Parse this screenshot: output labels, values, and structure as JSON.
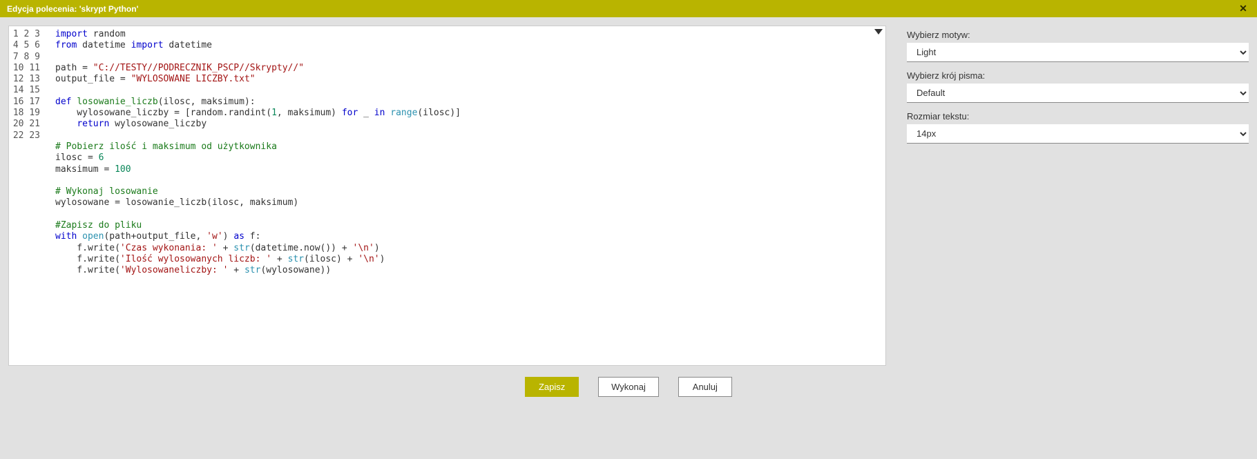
{
  "title": "Edycja polecenia: 'skrypt Python'",
  "close_symbol": "✕",
  "code": {
    "line_count": 23,
    "tokens": [
      [
        [
          "kw",
          "import"
        ],
        [
          "",
          " random"
        ]
      ],
      [
        [
          "kw",
          "from"
        ],
        [
          "",
          " datetime "
        ],
        [
          "kw",
          "import"
        ],
        [
          "",
          " datetime"
        ]
      ],
      [
        [
          "",
          ""
        ]
      ],
      [
        [
          "",
          "path = "
        ],
        [
          "str",
          "\"C://TESTY//PODRECZNIK_PSCP//Skrypty//\""
        ]
      ],
      [
        [
          "",
          "output_file = "
        ],
        [
          "str",
          "\"WYLOSOWANE LICZBY.txt\""
        ]
      ],
      [
        [
          "",
          ""
        ]
      ],
      [
        [
          "kw",
          "def"
        ],
        [
          "",
          " "
        ],
        [
          "fn",
          "losowanie_liczb"
        ],
        [
          "",
          "(ilosc, maksimum):"
        ]
      ],
      [
        [
          "",
          "    wylosowane_liczby = [random.randint("
        ],
        [
          "num",
          "1"
        ],
        [
          "",
          ", maksimum) "
        ],
        [
          "kw",
          "for"
        ],
        [
          "",
          " _ "
        ],
        [
          "kw",
          "in"
        ],
        [
          "",
          " "
        ],
        [
          "builtin",
          "range"
        ],
        [
          "",
          "(ilosc)]"
        ]
      ],
      [
        [
          "",
          "    "
        ],
        [
          "kw",
          "return"
        ],
        [
          "",
          " wylosowane_liczby"
        ]
      ],
      [
        [
          "",
          ""
        ]
      ],
      [
        [
          "cmt",
          "# Pobierz ilość i maksimum od użytkownika"
        ]
      ],
      [
        [
          "",
          "ilosc = "
        ],
        [
          "num",
          "6"
        ]
      ],
      [
        [
          "",
          "maksimum = "
        ],
        [
          "num",
          "100"
        ]
      ],
      [
        [
          "",
          ""
        ]
      ],
      [
        [
          "cmt",
          "# Wykonaj losowanie"
        ]
      ],
      [
        [
          "",
          "wylosowane = losowanie_liczb(ilosc, maksimum)"
        ]
      ],
      [
        [
          "",
          ""
        ]
      ],
      [
        [
          "cmt",
          "#Zapisz do pliku"
        ]
      ],
      [
        [
          "kw",
          "with"
        ],
        [
          "",
          " "
        ],
        [
          "builtin",
          "open"
        ],
        [
          "",
          "(path+output_file, "
        ],
        [
          "str",
          "'w'"
        ],
        [
          "",
          ") "
        ],
        [
          "kw",
          "as"
        ],
        [
          "",
          " f:"
        ]
      ],
      [
        [
          "",
          "    f.write("
        ],
        [
          "str",
          "'Czas wykonania: '"
        ],
        [
          "",
          " + "
        ],
        [
          "builtin",
          "str"
        ],
        [
          "",
          "(datetime.now()) + "
        ],
        [
          "str",
          "'\\n'"
        ],
        [
          "",
          ")"
        ]
      ],
      [
        [
          "",
          "    f.write("
        ],
        [
          "str",
          "'Ilość wylosowanych liczb: '"
        ],
        [
          "",
          " + "
        ],
        [
          "builtin",
          "str"
        ],
        [
          "",
          "(ilosc) + "
        ],
        [
          "str",
          "'\\n'"
        ],
        [
          "",
          ")"
        ]
      ],
      [
        [
          "",
          "    f.write("
        ],
        [
          "str",
          "'Wylosowaneliczby: '"
        ],
        [
          "",
          " + "
        ],
        [
          "builtin",
          "str"
        ],
        [
          "",
          "(wylosowane))"
        ]
      ],
      [
        [
          "",
          ""
        ]
      ]
    ]
  },
  "side": {
    "theme_label": "Wybierz motyw:",
    "theme_value": "Light",
    "font_label": "Wybierz krój pisma:",
    "font_value": "Default",
    "size_label": "Rozmiar tekstu:",
    "size_value": "14px"
  },
  "buttons": {
    "save": "Zapisz",
    "run": "Wykonaj",
    "cancel": "Anuluj"
  }
}
